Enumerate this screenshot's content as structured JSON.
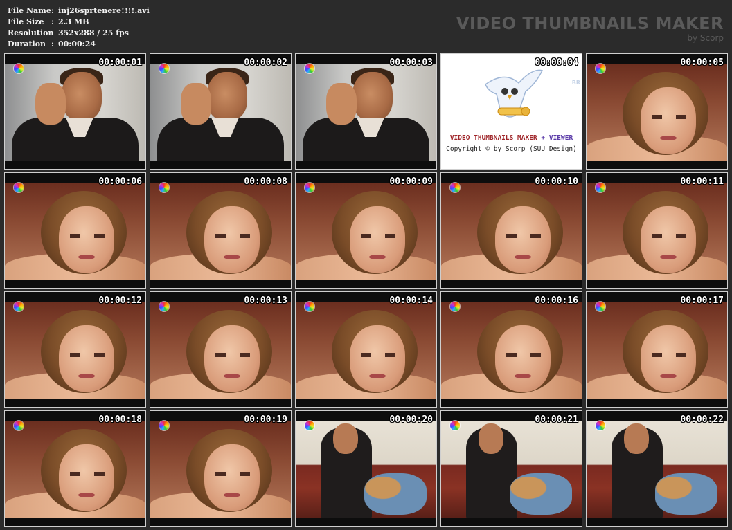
{
  "info": {
    "rows": [
      {
        "label": "File Name",
        "sep": ":",
        "value": "inj26sprtenere!!!!.avi"
      },
      {
        "label": "File Size",
        "sep": ":",
        "value": "2.3 MB"
      },
      {
        "label": "Resolution",
        "sep": ":",
        "value": "352x288 / 25 fps"
      },
      {
        "label": "Duration",
        "sep": ":",
        "value": "00:00:24"
      }
    ]
  },
  "brand": {
    "title": "VIDEO THUMBNAILS MAKER",
    "subtitle": "by Scorp"
  },
  "thumbnails": [
    {
      "time": "00:00:01",
      "scene": "man"
    },
    {
      "time": "00:00:02",
      "scene": "man"
    },
    {
      "time": "00:00:03",
      "scene": "man"
    },
    {
      "time": "00:00:04",
      "scene": "card"
    },
    {
      "time": "00:00:05",
      "scene": "woman"
    },
    {
      "time": "00:00:06",
      "scene": "woman"
    },
    {
      "time": "00:00:08",
      "scene": "woman"
    },
    {
      "time": "00:00:09",
      "scene": "woman"
    },
    {
      "time": "00:00:10",
      "scene": "woman"
    },
    {
      "time": "00:00:11",
      "scene": "woman"
    },
    {
      "time": "00:00:12",
      "scene": "woman"
    },
    {
      "time": "00:00:13",
      "scene": "woman"
    },
    {
      "time": "00:00:14",
      "scene": "woman"
    },
    {
      "time": "00:00:16",
      "scene": "woman"
    },
    {
      "time": "00:00:17",
      "scene": "woman"
    },
    {
      "time": "00:00:18",
      "scene": "woman"
    },
    {
      "time": "00:00:19",
      "scene": "woman"
    },
    {
      "time": "00:00:20",
      "scene": "room"
    },
    {
      "time": "00:00:21",
      "scene": "room"
    },
    {
      "time": "00:00:22",
      "scene": "room"
    }
  ],
  "card": {
    "title_part1": "VIDEO THUMBNAILS MAKER",
    "title_plus": "+",
    "title_part2": "VIEWER",
    "copyright": "Copyright © by Scorp (SUU Design)",
    "faint": "BR"
  },
  "colors": {
    "background": "#2b2b2b",
    "info_text": "#f2f2f2",
    "brand_text": "#5a5a5a",
    "thumb_border": "#cfcfcf"
  }
}
